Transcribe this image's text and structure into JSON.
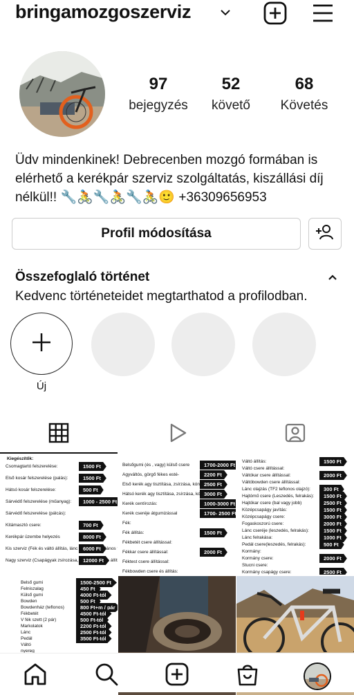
{
  "profile": {
    "username": "bringamozgoszerviz",
    "stats": [
      {
        "value": "97",
        "label": "bejegyzés"
      },
      {
        "value": "52",
        "label": "követő"
      },
      {
        "value": "68",
        "label": "Követés"
      }
    ],
    "bio": "Üdv mindenkinek! Debrecenben mozgó formában is elérhető a kerékpár szerviz szolgáltatás, kiszállási díj nélkül!! 🔧🚴🔧🚴🔧🚴🙂 +36309656953",
    "edit_button": "Profil módosítása"
  },
  "highlights": {
    "title": "Összefoglaló történet",
    "subtitle": "Kedvenc történeteidet megtarthatod a profilodban.",
    "new_label": "Új"
  },
  "tabs": [
    "grid-icon",
    "reels-icon",
    "tagged-icon"
  ],
  "posts": {
    "p1": {
      "heading": "Kiegészítők:",
      "rows": [
        {
          "label": "Csomagtartó felszerelése:",
          "price": "1500 Ft"
        },
        {
          "label": "Első kosár felszerelése (palás):",
          "price": "1500 Ft"
        },
        {
          "label": "Hátsó kosár felszerelése:",
          "price": "500 Ft"
        },
        {
          "label": "Sárvédő felszerelése (műanyag):",
          "price": "1000 - 2500 Ft"
        },
        {
          "label": "Sárvédő felszerelése (pálcás):",
          "price": ""
        },
        {
          "label": "Kitámasztó csere:",
          "price": "700 Ft"
        },
        {
          "label": "Kerékpár üzembe helyezés",
          "price": "8000 Ft"
        },
        {
          "label": "Kis szerviz (Fék és váltó állítás, lánc olajozás, általános tisztítás",
          "price": "6000 Ft"
        },
        {
          "label": "Nagy szerviz (Csapágyak zsírozása, fékek és váltók állítása, centírozás első és hátsó kerék, lánc olajozás, általános tisztítás",
          "price": "12000 Ft"
        }
      ]
    },
    "p2": {
      "rows": [
        {
          "label": "Belsőgumi (és , vagy) külső csere",
          "price": "1700-2000 Ft"
        },
        {
          "label": "Agyváltós, görgő fékes esté-",
          "price": "2200 Ft"
        },
        {
          "label": "Első kerék agy tisztítása, zsírzása, kónusz állítás:",
          "price": "2500 Ft"
        },
        {
          "label": "Hátsó kerék agy tisztítása, zsírzása, kónusz állítás:",
          "price": "3000 Ft"
        },
        {
          "label": "Kerék centírozás:",
          "price": "1000-3000 Ft"
        },
        {
          "label": "Kerék cseréje átgumizással",
          "price": "1700- 2500 Ft"
        },
        {
          "label": "Fék:",
          "price": ""
        },
        {
          "label": "Fék állítás:",
          "price": "1500 Ft"
        },
        {
          "label": "Fékbetét csere állítással:",
          "price": ""
        },
        {
          "label": "Fékkar csere állítással:",
          "price": "2000 Ft"
        },
        {
          "label": "Féktest csere állítással:",
          "price": ""
        },
        {
          "label": "Fékbowden csere és állítás:",
          "price": ""
        }
      ]
    },
    "p3": {
      "rows": [
        {
          "label": "Váltó állítás:",
          "price": "1500 Ft"
        },
        {
          "label": "Váltó csere állítással:",
          "price": ""
        },
        {
          "label": "Váltókar csere állítással:",
          "price": "2000 Ft"
        },
        {
          "label": "Váltóbowden csere állítással:",
          "price": ""
        },
        {
          "label": "Lánc olajzás (TF2 teflonos olajzó):",
          "price": "300 Ft"
        },
        {
          "label": "Hajtómű csere (Leszedés, felrakás):",
          "price": "1500 Ft"
        },
        {
          "label": "Hajtókar csere (bal vagy jobb)",
          "price": "2500 Ft"
        },
        {
          "label": "Középcsapágy javítás:",
          "price": "1500 Ft"
        },
        {
          "label": "Középcsapágy csere:",
          "price": "3000 Ft"
        },
        {
          "label": "Fogaskoszorú csere:",
          "price": "2000 Ft"
        },
        {
          "label": "Lánc cseréje (leszedés, felrakás):",
          "price": "1500 Ft"
        },
        {
          "label": "Lánc felrakása:",
          "price": "1000 Ft"
        },
        {
          "label": "Pedál csere(leszedés, felrakás):",
          "price": "500 Ft"
        },
        {
          "label": "Kormány:",
          "price": ""
        },
        {
          "label": "Kormány csere:",
          "price": "2000 Ft"
        },
        {
          "label": "Stucni csere:",
          "price": ""
        },
        {
          "label": "Kormány csapágy csere:",
          "price": "2500 Ft"
        }
      ]
    },
    "p4": {
      "rows": [
        {
          "label": "Belső gumi",
          "price": "1500-2500 Ft"
        },
        {
          "label": "Felniszalag",
          "price": "450 Ft"
        },
        {
          "label": "Külső gumi",
          "price": "4000 Ft-tól"
        },
        {
          "label": "Bowden",
          "price": "500 Ft"
        },
        {
          "label": "Bowdenház (teflonos)",
          "price": "800 Ft+m / pár"
        },
        {
          "label": "Fékbetét",
          "price": "4500 Ft-tól"
        },
        {
          "label": "V fék szett (2 pár)",
          "price": "500 Ft-tól"
        },
        {
          "label": "Markolatok",
          "price": "2200 Ft-tól"
        },
        {
          "label": "Lánc",
          "price": "2500 Ft-tól"
        },
        {
          "label": "Pedál",
          "price": "3500 Ft-tól"
        },
        {
          "label": "Váltó",
          "price": ""
        },
        {
          "label": "nyereg",
          "price": ""
        }
      ]
    }
  },
  "nav": [
    "home-icon",
    "search-icon",
    "create-icon",
    "shop-icon",
    "profile-avatar"
  ]
}
